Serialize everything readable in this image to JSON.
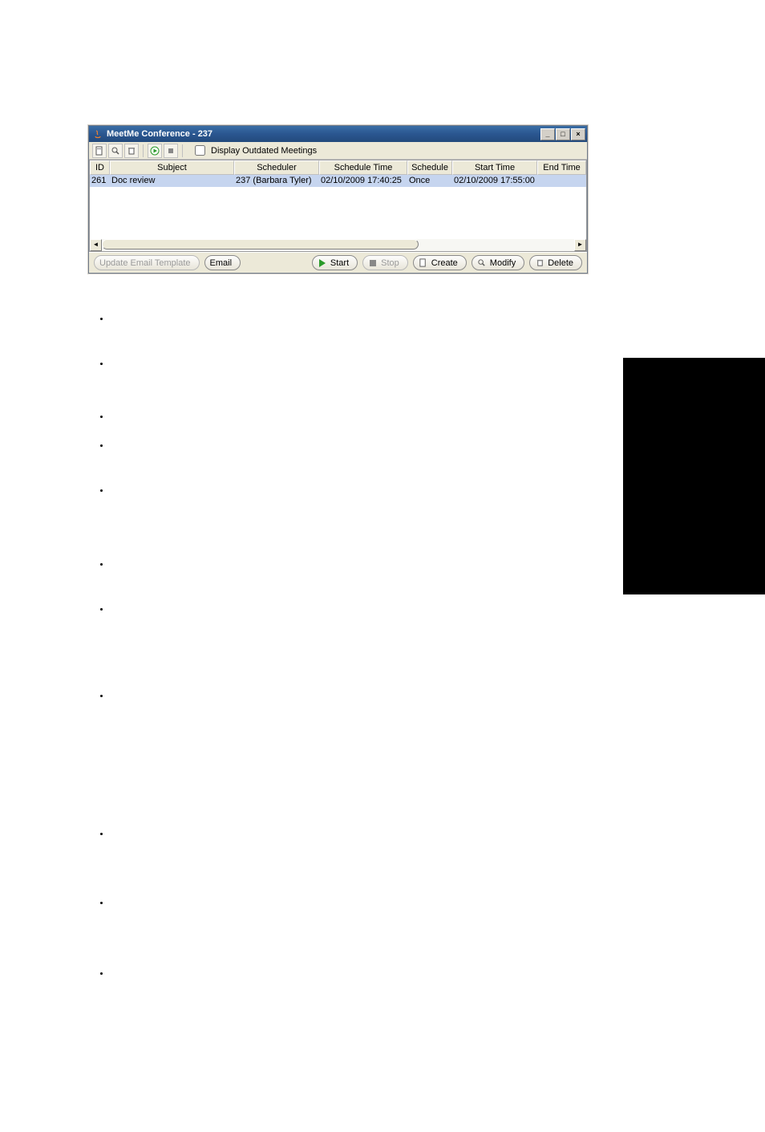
{
  "window": {
    "title": "MeetMe Conference - 237"
  },
  "toolbar": {
    "display_outdated_label": "Display Outdated Meetings"
  },
  "table": {
    "headers": {
      "id": "ID",
      "subject": "Subject",
      "scheduler": "Scheduler",
      "schedule_time": "Schedule Time",
      "schedule": "Schedule",
      "start_time": "Start Time",
      "end_time": "End Time"
    },
    "rows": [
      {
        "id": "261",
        "subject": "Doc review",
        "scheduler": "237 (Barbara Tyler)",
        "schedule_time": "02/10/2009 17:40:25",
        "schedule": "Once",
        "start_time": "02/10/2009 17:55:00",
        "end_time": ""
      }
    ]
  },
  "footer": {
    "update_email_template": "Update Email Template",
    "email": "Email",
    "start": "Start",
    "stop": "Stop",
    "create": "Create",
    "modify": "Modify",
    "delete": "Delete"
  }
}
